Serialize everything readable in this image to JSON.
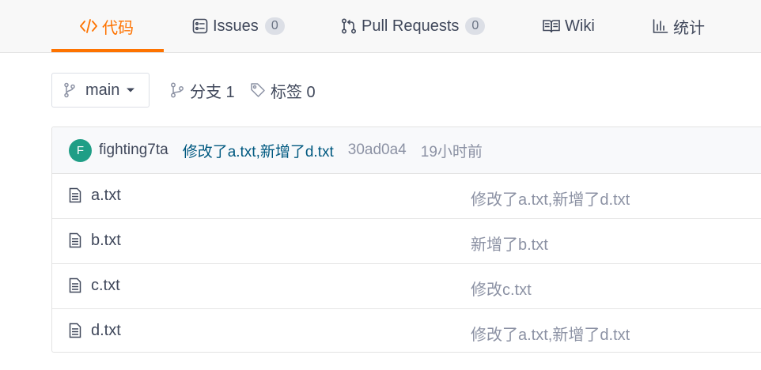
{
  "tabs": [
    {
      "label": "代码",
      "icon": "code-icon",
      "active": true
    },
    {
      "label": "Issues",
      "icon": "issues-icon",
      "count": "0"
    },
    {
      "label": "Pull Requests",
      "icon": "pull-request-icon",
      "count": "0"
    },
    {
      "label": "Wiki",
      "icon": "book-icon"
    },
    {
      "label": "统计",
      "icon": "bar-chart-icon"
    }
  ],
  "toolbar": {
    "branch": "main",
    "branches_label": "分支 1",
    "tags_label": "标签 0"
  },
  "latest_commit": {
    "avatar_letter": "F",
    "author": "fighting7ta",
    "message": "修改了a.txt,新增了d.txt",
    "hash": "30ad0a4",
    "time": "19小时前"
  },
  "files": [
    {
      "name": "a.txt",
      "message": "修改了a.txt,新增了d.txt"
    },
    {
      "name": "b.txt",
      "message": "新增了b.txt"
    },
    {
      "name": "c.txt",
      "message": "修改c.txt"
    },
    {
      "name": "d.txt",
      "message": "修改了a.txt,新增了d.txt"
    }
  ],
  "colors": {
    "accent": "#fe7300",
    "avatar": "#1f9e86",
    "commit_link": "#005980",
    "muted": "#8c92a4"
  }
}
